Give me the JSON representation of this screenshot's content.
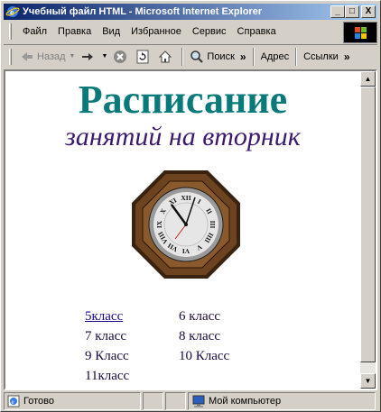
{
  "window": {
    "title": "Учебный файл HTML - Microsoft Internet Explorer"
  },
  "title_buttons": {
    "minimize": "_",
    "maximize": "□",
    "close": "X"
  },
  "menu": {
    "items": [
      {
        "label": "Файл"
      },
      {
        "label": "Правка"
      },
      {
        "label": "Вид"
      },
      {
        "label": "Избранное"
      },
      {
        "label": "Сервис"
      },
      {
        "label": "Справка"
      }
    ]
  },
  "toolbar": {
    "back_label": "Назад",
    "search_label": "Поиск",
    "address_label": "Адрес",
    "links_label": "Ссылки"
  },
  "page": {
    "heading": "Расписание",
    "subheading": "занятий на вторник",
    "classes": [
      {
        "label": "5класс",
        "link": true
      },
      {
        "label": "6 класс",
        "link": false
      },
      {
        "label": "7 класс",
        "link": false
      },
      {
        "label": "8 класс",
        "link": false
      },
      {
        "label": "9 Класс",
        "link": false
      },
      {
        "label": "10 Класс",
        "link": false
      },
      {
        "label": "11класс",
        "link": false
      }
    ]
  },
  "clock": {
    "numerals": [
      "XII",
      "I",
      "II",
      "III",
      "IIII",
      "V",
      "VI",
      "VII",
      "VIII",
      "IX",
      "X",
      "XI"
    ]
  },
  "statusbar": {
    "status_text": "Готово",
    "zone_text": "Мой компьютер"
  },
  "colors": {
    "heading": "#087a7a",
    "subheading": "#3b1a6e",
    "link": "#1a0a8c",
    "titlebar": "#0a246a"
  }
}
